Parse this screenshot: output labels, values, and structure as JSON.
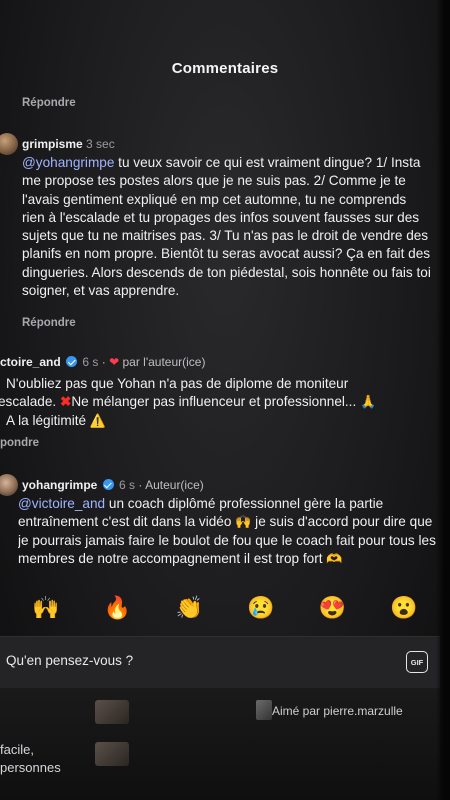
{
  "header": {
    "title": "Commentaires"
  },
  "reply_label": "Répondre",
  "comment1": {
    "username": "grimpisme",
    "time": "3 sec",
    "mention": "@yohangrimpe",
    "text": " tu veux savoir ce qui est vraiment dingue? 1/ Insta me propose tes postes alors que je ne suis pas. 2/ Comme je te l'avais gentiment expliqué en mp cet automne, tu ne comprends rien à l'escalade et tu propages des infos souvent fausses sur des sujets que tu ne maitrises pas. 3/ Tu n'as pas le droit de vendre des planifs en nom propre. Bientôt tu seras avocat aussi? Ça en fait des dingueries. Alors descends de ton piédestal, sois honnête ou fais toi soigner, et vas apprendre."
  },
  "comment2": {
    "username": "ctoire_and",
    "time": "6 s",
    "liked_by_author": "par l'auteur(ice)",
    "line1": "N'oubliez pas que Yohan n'a pas de diplome de moniteur",
    "line2a": "escalade. ",
    "line2b": "Ne mélanger pas influenceur et professionnel...",
    "line3": "A la légitimité",
    "reply_partial": "pondre"
  },
  "comment3": {
    "username": "yohangrimpe",
    "time": "6 s",
    "badge": "Auteur(ice)",
    "mention": "@victoire_and",
    "text_a": " un coach diplômé professionnel gère la partie entraînement c'est dit dans la vidéo ",
    "text_b": " je suis d'accord pour dire que je pourrais jamais faire le boulot de fou que le coach fait pour tous les membres de notre accompagnement il est trop fort"
  },
  "reactions": [
    "🙌",
    "🔥",
    "👏",
    "😢",
    "😍",
    "😮"
  ],
  "composer": {
    "placeholder": "Qu'en pensez-vous ?",
    "gif_label": "GIF"
  },
  "background": {
    "liked_by": "Aimé par pierre.marzulle",
    "text_line1": "facile,",
    "text_line2": "personnes"
  }
}
